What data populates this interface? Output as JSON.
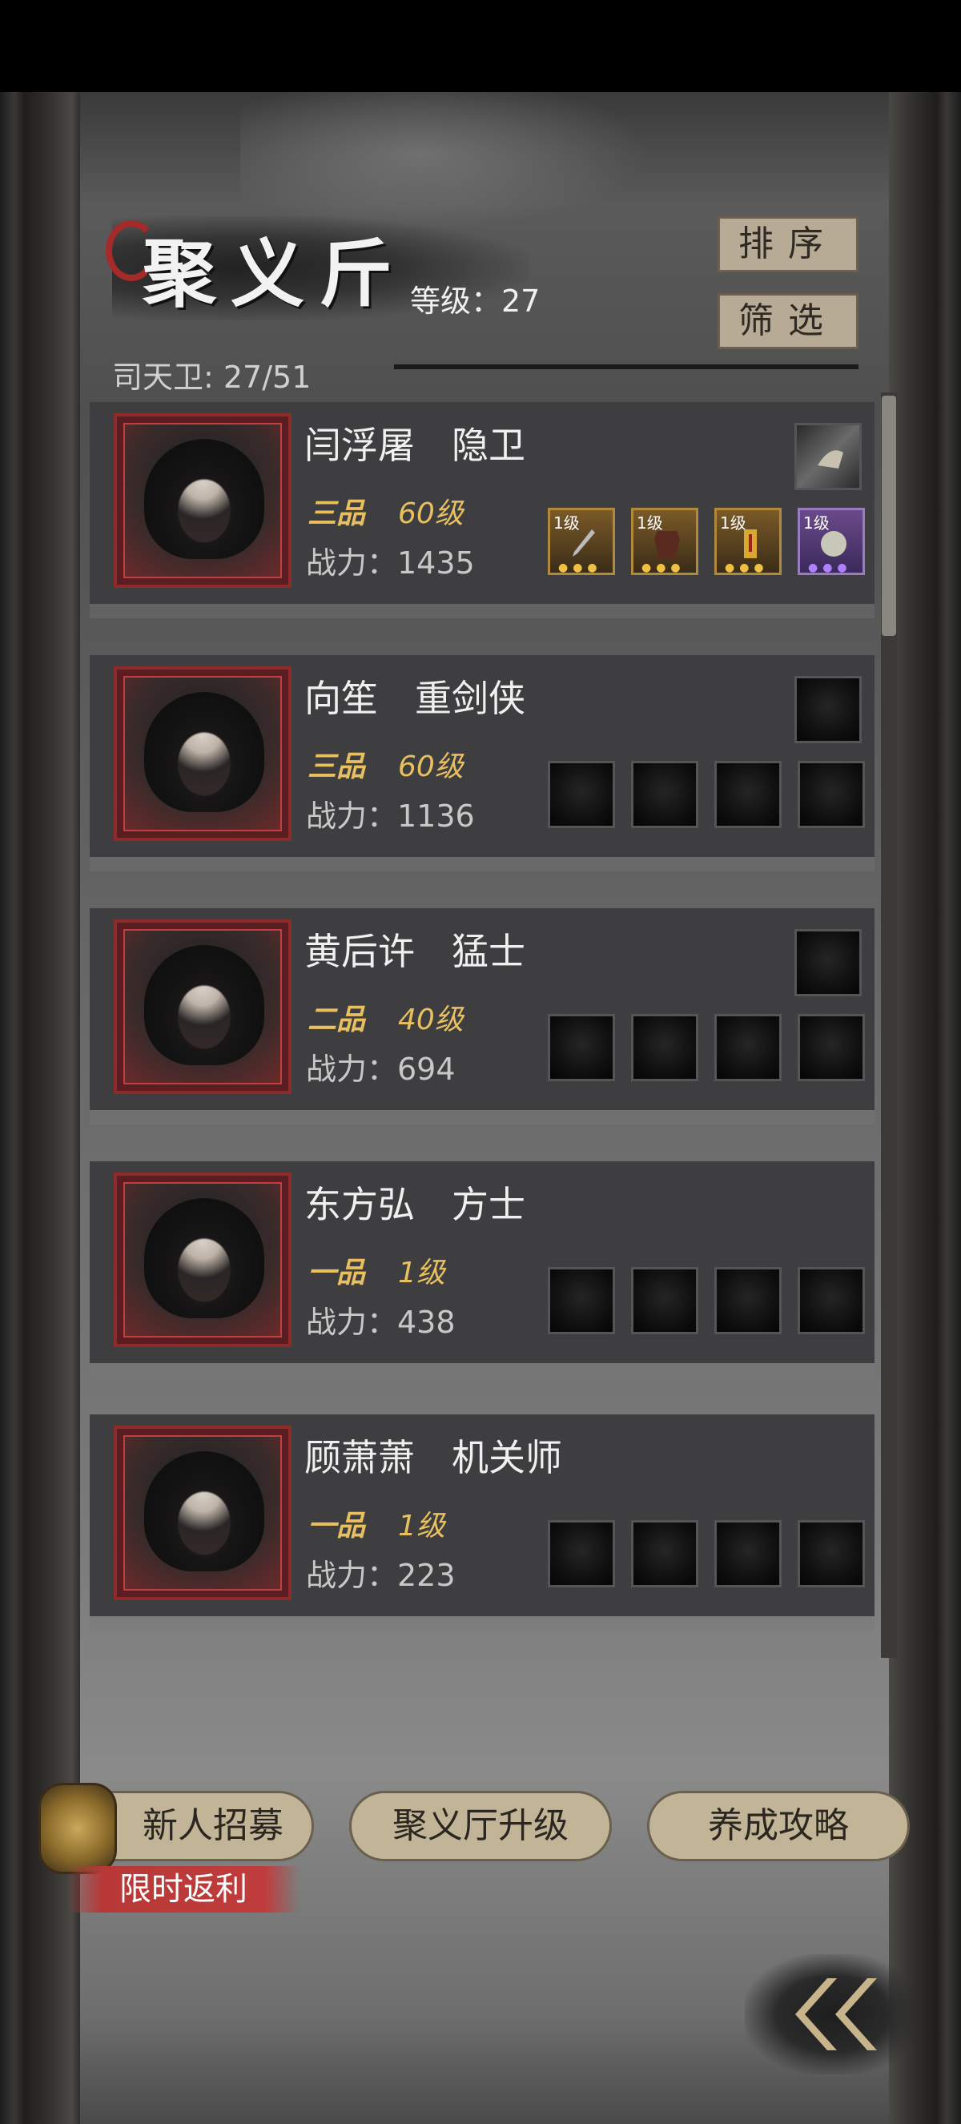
{
  "header": {
    "title": "聚义斤",
    "level_label": "等级：27",
    "roster_count": "司天卫: 27/51",
    "sort_label": "排序",
    "filter_label": "筛选"
  },
  "characters": [
    {
      "name": "闫浮屠　隐卫",
      "rank": "三品",
      "level": "60级",
      "power": "战力：1435",
      "slots": [
        {
          "level": "1级",
          "item": "dagger"
        },
        {
          "level": "1级",
          "item": "armor"
        },
        {
          "level": "1级",
          "item": "scroll"
        },
        {
          "level": "1级",
          "item": "orb"
        }
      ],
      "accessory": "comb"
    },
    {
      "name": "向笙　重剑侠",
      "rank": "三品",
      "level": "60级",
      "power": "战力：1136"
    },
    {
      "name": "黄后许　猛士",
      "rank": "二品",
      "level": "40级",
      "power": "战力：694"
    },
    {
      "name": "东方弘　方士",
      "rank": "一品",
      "level": "1级",
      "power": "战力：438"
    },
    {
      "name": "顾萧萧　机关师",
      "rank": "一品",
      "level": "1级",
      "power": "战力：223"
    }
  ],
  "footer": {
    "recruit_label": "新人招募",
    "promo_label": "限时返利",
    "upgrade_label": "聚义厅升级",
    "guide_label": "养成攻略"
  },
  "icons": {
    "back": "double-chevron-left-icon",
    "recruit": "recruit-token-icon"
  },
  "colors": {
    "rank_gold": "#e8c060",
    "portrait_frame": "#8d2a2a",
    "button_tan": "#c2b597",
    "promo_red": "#c03c3c"
  }
}
